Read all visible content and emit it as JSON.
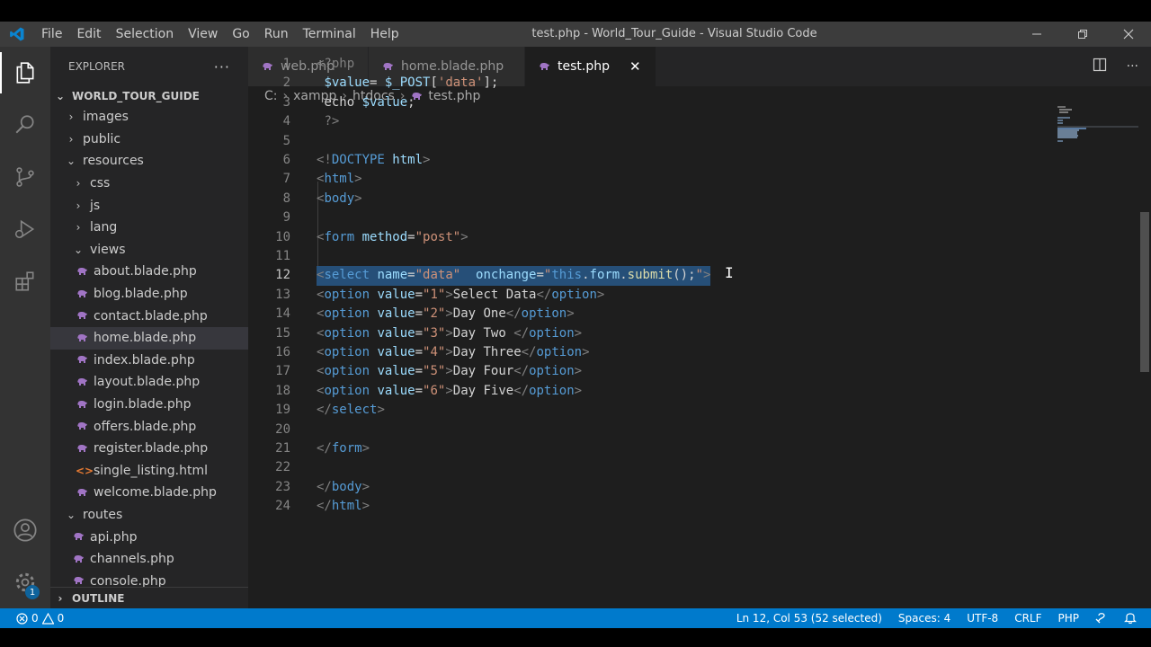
{
  "window": {
    "title": "test.php - World_Tour_Guide - Visual Studio Code",
    "menu": [
      "File",
      "Edit",
      "Selection",
      "View",
      "Go",
      "Run",
      "Terminal",
      "Help"
    ]
  },
  "activity_bar": {
    "items": [
      "explorer-icon",
      "search-icon",
      "source-control-icon",
      "run-debug-icon",
      "extensions-icon"
    ],
    "bottom": [
      "account-icon",
      "settings-gear-icon"
    ],
    "settings_badge": "1"
  },
  "explorer": {
    "header": "EXPLORER",
    "more": "···",
    "root": "WORLD_TOUR_GUIDE",
    "items": [
      {
        "label": "images",
        "depth": 1,
        "kind": "folder-closed"
      },
      {
        "label": "public",
        "depth": 1,
        "kind": "folder-closed"
      },
      {
        "label": "resources",
        "depth": 1,
        "kind": "folder-open"
      },
      {
        "label": "css",
        "depth": 2,
        "kind": "folder-closed"
      },
      {
        "label": "js",
        "depth": 2,
        "kind": "folder-closed"
      },
      {
        "label": "lang",
        "depth": 2,
        "kind": "folder-closed"
      },
      {
        "label": "views",
        "depth": 2,
        "kind": "folder-open"
      },
      {
        "label": "about.blade.php",
        "depth": 3,
        "kind": "php"
      },
      {
        "label": "blog.blade.php",
        "depth": 3,
        "kind": "php"
      },
      {
        "label": "contact.blade.php",
        "depth": 3,
        "kind": "php"
      },
      {
        "label": "home.blade.php",
        "depth": 3,
        "kind": "php",
        "selected": true
      },
      {
        "label": "index.blade.php",
        "depth": 3,
        "kind": "php"
      },
      {
        "label": "layout.blade.php",
        "depth": 3,
        "kind": "php"
      },
      {
        "label": "login.blade.php",
        "depth": 3,
        "kind": "php"
      },
      {
        "label": "offers.blade.php",
        "depth": 3,
        "kind": "php"
      },
      {
        "label": "register.blade.php",
        "depth": 3,
        "kind": "php"
      },
      {
        "label": "single_listing.html",
        "depth": 3,
        "kind": "html"
      },
      {
        "label": "welcome.blade.php",
        "depth": 3,
        "kind": "php"
      },
      {
        "label": "routes",
        "depth": 1,
        "kind": "folder-open"
      },
      {
        "label": "api.php",
        "depth": 2,
        "kind": "php"
      },
      {
        "label": "channels.php",
        "depth": 2,
        "kind": "php"
      },
      {
        "label": "console.php",
        "depth": 2,
        "kind": "php"
      }
    ],
    "outline": "OUTLINE"
  },
  "tabs": [
    {
      "label": "web.php",
      "active": false
    },
    {
      "label": "home.blade.php",
      "active": false
    },
    {
      "label": "test.php",
      "active": true
    }
  ],
  "breadcrumb": [
    "C:",
    "xampp",
    "htdocs",
    "test.php"
  ],
  "code": {
    "current_line": 12,
    "lines": [
      [
        [
          "tg",
          "<?php"
        ]
      ],
      [
        [
          "tx",
          " "
        ],
        [
          "var",
          "$value"
        ],
        [
          "tx",
          "= "
        ],
        [
          "var",
          "$_POST"
        ],
        [
          "tx",
          "["
        ],
        [
          "st",
          "'data'"
        ],
        [
          "tx",
          "];"
        ]
      ],
      [
        [
          "tx",
          " echo "
        ],
        [
          "var",
          "$value"
        ],
        [
          "tx",
          ";"
        ]
      ],
      [
        [
          "tx",
          " "
        ],
        [
          "tg",
          "?>"
        ]
      ],
      [],
      [
        [
          "tg",
          "<!"
        ],
        [
          "tn",
          "DOCTYPE"
        ],
        [
          "at",
          " html"
        ],
        [
          "tg",
          ">"
        ]
      ],
      [
        [
          "tg",
          "<"
        ],
        [
          "tn",
          "html"
        ],
        [
          "tg",
          ">"
        ]
      ],
      [
        [
          "tg",
          "<"
        ],
        [
          "tn",
          "body"
        ],
        [
          "tg",
          ">"
        ]
      ],
      [],
      [
        [
          "tg",
          "<"
        ],
        [
          "tn",
          "form"
        ],
        [
          "at",
          " method"
        ],
        [
          "tx",
          "="
        ],
        [
          "st",
          "\"post\""
        ],
        [
          "tg",
          ">"
        ]
      ],
      [],
      [
        [
          "tg",
          "<"
        ],
        [
          "tn",
          "select"
        ],
        [
          "at",
          " name"
        ],
        [
          "tx",
          "="
        ],
        [
          "st",
          "\"data\""
        ],
        [
          "tx",
          "  "
        ],
        [
          "at",
          "onchange"
        ],
        [
          "tx",
          "="
        ],
        [
          "st",
          "\""
        ],
        [
          "tn",
          "this"
        ],
        [
          "tx",
          "."
        ],
        [
          "at",
          "form"
        ],
        [
          "tx",
          "."
        ],
        [
          "fn",
          "submit"
        ],
        [
          "tx",
          "();"
        ],
        [
          "st",
          "\""
        ],
        [
          "tg",
          ">"
        ]
      ],
      [
        [
          "tg",
          "<"
        ],
        [
          "tn",
          "option"
        ],
        [
          "at",
          " value"
        ],
        [
          "tx",
          "="
        ],
        [
          "st",
          "\"1\""
        ],
        [
          "tg",
          ">"
        ],
        [
          "tx",
          "Select Data"
        ],
        [
          "tg",
          "</"
        ],
        [
          "tn",
          "option"
        ],
        [
          "tg",
          ">"
        ]
      ],
      [
        [
          "tg",
          "<"
        ],
        [
          "tn",
          "option"
        ],
        [
          "at",
          " value"
        ],
        [
          "tx",
          "="
        ],
        [
          "st",
          "\"2\""
        ],
        [
          "tg",
          ">"
        ],
        [
          "tx",
          "Day One"
        ],
        [
          "tg",
          "</"
        ],
        [
          "tn",
          "option"
        ],
        [
          "tg",
          ">"
        ]
      ],
      [
        [
          "tg",
          "<"
        ],
        [
          "tn",
          "option"
        ],
        [
          "at",
          " value"
        ],
        [
          "tx",
          "="
        ],
        [
          "st",
          "\"3\""
        ],
        [
          "tg",
          ">"
        ],
        [
          "tx",
          "Day Two "
        ],
        [
          "tg",
          "</"
        ],
        [
          "tn",
          "option"
        ],
        [
          "tg",
          ">"
        ]
      ],
      [
        [
          "tg",
          "<"
        ],
        [
          "tn",
          "option"
        ],
        [
          "at",
          " value"
        ],
        [
          "tx",
          "="
        ],
        [
          "st",
          "\"4\""
        ],
        [
          "tg",
          ">"
        ],
        [
          "tx",
          "Day Three"
        ],
        [
          "tg",
          "</"
        ],
        [
          "tn",
          "option"
        ],
        [
          "tg",
          ">"
        ]
      ],
      [
        [
          "tg",
          "<"
        ],
        [
          "tn",
          "option"
        ],
        [
          "at",
          " value"
        ],
        [
          "tx",
          "="
        ],
        [
          "st",
          "\"5\""
        ],
        [
          "tg",
          ">"
        ],
        [
          "tx",
          "Day Four"
        ],
        [
          "tg",
          "</"
        ],
        [
          "tn",
          "option"
        ],
        [
          "tg",
          ">"
        ]
      ],
      [
        [
          "tg",
          "<"
        ],
        [
          "tn",
          "option"
        ],
        [
          "at",
          " value"
        ],
        [
          "tx",
          "="
        ],
        [
          "st",
          "\"6\""
        ],
        [
          "tg",
          ">"
        ],
        [
          "tx",
          "Day Five"
        ],
        [
          "tg",
          "</"
        ],
        [
          "tn",
          "option"
        ],
        [
          "tg",
          ">"
        ]
      ],
      [
        [
          "tg",
          "</"
        ],
        [
          "tn",
          "select"
        ],
        [
          "tg",
          ">"
        ]
      ],
      [],
      [
        [
          "tg",
          "</"
        ],
        [
          "tn",
          "form"
        ],
        [
          "tg",
          ">"
        ]
      ],
      [],
      [
        [
          "tg",
          "</"
        ],
        [
          "tn",
          "body"
        ],
        [
          "tg",
          ">"
        ]
      ],
      [
        [
          "tg",
          "</"
        ],
        [
          "tn",
          "html"
        ],
        [
          "tg",
          ">"
        ]
      ]
    ]
  },
  "status": {
    "problems": "0",
    "warnings": "0",
    "position": "Ln 12, Col 53 (52 selected)",
    "spaces": "Spaces: 4",
    "encoding": "UTF-8",
    "eol": "CRLF",
    "language": "PHP"
  },
  "colors": {
    "accent": "#007acc",
    "titlebar": "#3c3c3c",
    "editor_bg": "#1e1e1e",
    "sidebar_bg": "#252526",
    "php_icon": "#a074c4"
  }
}
